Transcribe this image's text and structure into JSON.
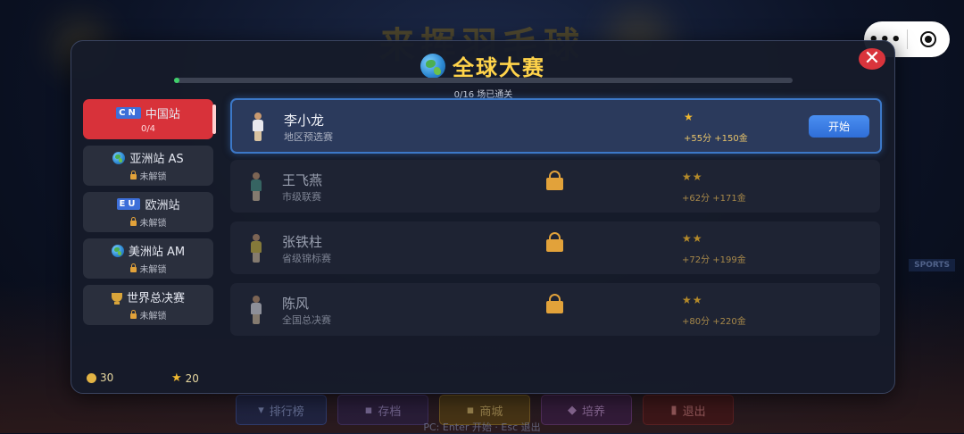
{
  "background": {
    "title": "来挥羽毛球",
    "sign": "SPORTS",
    "bottom_buttons": [
      {
        "label": "排行榜",
        "icon": "trophy-icon"
      },
      {
        "label": "存档",
        "icon": "save-icon"
      },
      {
        "label": "商城",
        "icon": "shop-icon"
      },
      {
        "label": "培养",
        "icon": "muscle-icon"
      },
      {
        "label": "退出",
        "icon": "exit-icon"
      }
    ],
    "hint": "PC: Enter 开始 · Esc 退出"
  },
  "capsule": {
    "more": "•••",
    "record_icon": "target-icon"
  },
  "modal": {
    "title": "全球大赛",
    "title_icon": "globe-icon",
    "close": "✕",
    "progress_fraction": 0.0,
    "progress_text": "0/16 场已通关"
  },
  "sidebar": {
    "items": [
      {
        "badge": "CN",
        "label": "中国站",
        "sub": "0/4",
        "active": true
      },
      {
        "icon": "globe-icon",
        "label": "亚洲站 AS",
        "sub": "未解锁"
      },
      {
        "badge": "EU",
        "label": "欧洲站",
        "sub": "未解锁"
      },
      {
        "icon": "globe-icon",
        "label": "美洲站 AM",
        "sub": "未解锁"
      },
      {
        "icon": "trophy-icon",
        "label": "世界总决赛",
        "sub": "未解锁"
      }
    ],
    "coins": "30",
    "stars": "20"
  },
  "matches": [
    {
      "name": "李小龙",
      "stage": "地区预选赛",
      "stars": "★",
      "reward": "+55分 +150金",
      "action": "开始",
      "locked": false,
      "shirt": "#e8e8ee"
    },
    {
      "name": "王飞燕",
      "stage": "市级联赛",
      "stars": "★★",
      "reward": "+62分 +171金",
      "locked": true,
      "shirt": "#4a9a8a"
    },
    {
      "name": "张铁柱",
      "stage": "省级锦标赛",
      "stars": "★★",
      "reward": "+72分 +199金",
      "locked": true,
      "shirt": "#d8c040"
    },
    {
      "name": "陈风",
      "stage": "全国总决赛",
      "stars": "★★",
      "reward": "+80分 +220金",
      "locked": true,
      "shirt": "#e8e8ee"
    }
  ],
  "colors": {
    "accent_red": "#d8323a",
    "gold": "#ffd34a",
    "button_blue": "#3a7fe6",
    "progress_green": "#3fcf6a"
  }
}
